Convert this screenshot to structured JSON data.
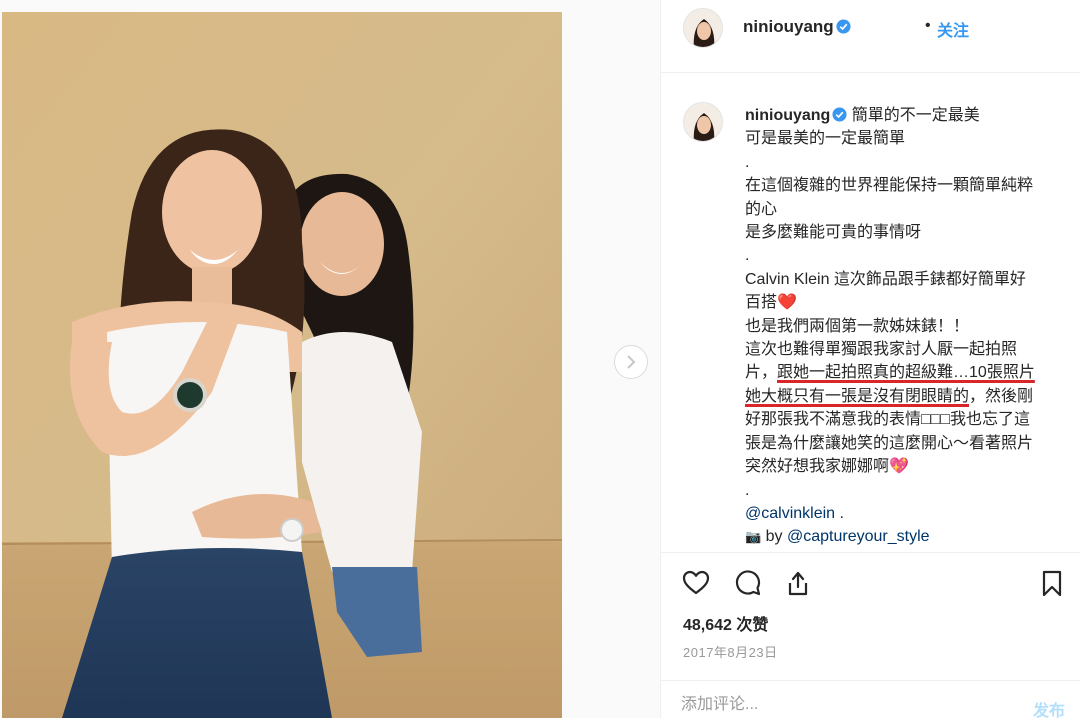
{
  "post": {
    "username": "niniouyang",
    "follow_dot": "•",
    "follow_label": "关注",
    "verified_icon": "verified-badge-icon",
    "caption": {
      "line1": "簡單的不一定最美",
      "line2": "可是最美的一定最簡單",
      "dot1": ".",
      "line3": "在這個複雜的世界裡能保持一顆簡單純粹",
      "line4": "的心",
      "line5": "是多麼難能可貴的事情呀",
      "dot2": ".",
      "line6": "Calvin Klein 這次飾品跟手錶都好簡單好",
      "line7": "百搭",
      "heart_emoji": "❤️",
      "line8": "也是我們兩個第一款姊妹錶！！",
      "line9": "這次也難得單獨跟我家討人厭一起拍照",
      "line10a": "片，",
      "line10b": "跟她一起拍照真的超級難…10張照片",
      "line11a": "她大概只有一張是沒有閉眼睛的",
      "line11b": "，然後剛",
      "line12": "好那張我不滿意我的表情□□□我也忘了這",
      "line13": "張是為什麼讓她笑的這麼開心～看著照片",
      "line14": "突然好想我家娜娜啊",
      "sparkle_heart": "💖",
      "dot3": ".",
      "mention": "@calvinklein",
      "mention_suffix": " .",
      "camera_emoji": "📷",
      "by_label": " by ",
      "credit": "@captureyour_style"
    },
    "likes": "48,642 次赞",
    "date": "2017年8月23日",
    "comment_placeholder": "添加评论...",
    "post_label": "发布",
    "colors": {
      "accent": "#3897f0",
      "highlight_underline": "#d9262b",
      "link": "#003569",
      "post_disabled": "#b2dffc"
    },
    "icons": [
      "heart-icon",
      "comment-icon",
      "share-icon",
      "bookmark-icon",
      "chevron-right-icon"
    ]
  }
}
